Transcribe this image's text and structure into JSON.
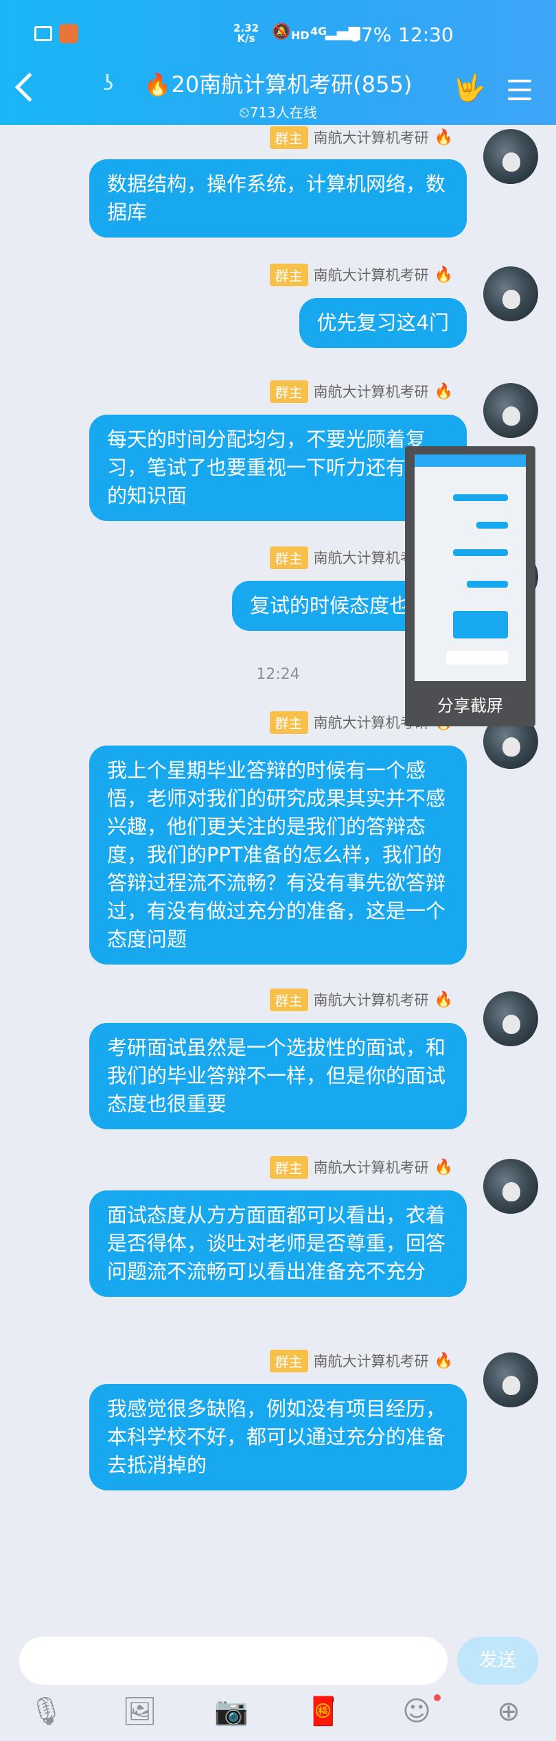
{
  "status_bar": {
    "speed_value": "2.32",
    "speed_unit": "K/s",
    "hd": "HD",
    "net": "4G",
    "battery": "67%",
    "time": "12:30"
  },
  "header": {
    "title": "🔥20南航计算机考研(855)",
    "online": "⏲713人在线"
  },
  "messages": [
    {
      "role": "群主",
      "sender": "南航大计算机考研",
      "text": "数据结构，操作系统，计算机网络，数据库"
    },
    {
      "role": "群主",
      "sender": "南航大计算机考研",
      "text": "优先复习这4门"
    },
    {
      "role": "群主",
      "sender": "南航大计算机考研",
      "text": "每天的时间分配均匀，不要光顾着复习，笔试了也要重视一下听力还有面试的知识面"
    },
    {
      "role": "群主",
      "sender": "南航大计算机考研",
      "text": "复试的时候态度也很重"
    },
    {
      "role": "群主",
      "sender": "南航大计算机考研",
      "text": "我上个星期毕业答辩的时候有一个感悟，老师对我们的研究成果其实并不感兴趣，他们更关注的是我们的答辩态度，我们的PPT准备的怎么样，我们的答辩过程流不流畅？有没有事先欲答辩过，有没有做过充分的准备，这是一个态度问题"
    },
    {
      "role": "群主",
      "sender": "南航大计算机考研",
      "text": "考研面试虽然是一个选拔性的面试，和我们的毕业答辩不一样，但是你的面试态度也很重要"
    },
    {
      "role": "群主",
      "sender": "南航大计算机考研",
      "text": "面试态度从方方面面都可以看出，衣着是否得体，谈吐对老师是否尊重，回答问题流不流畅可以看出准备充不充分"
    },
    {
      "role": "群主",
      "sender": "南航大计算机考研",
      "text": "我感觉很多缺陷，例如没有项目经历，本科学校不好，都可以通过充分的准备去抵消掉的"
    }
  ],
  "timestamp": "12:24",
  "share_popup": {
    "label": "分享截屏"
  },
  "input": {
    "placeholder": "",
    "send_label": "发送"
  },
  "toolbar_icons": [
    "microphone-icon",
    "image-icon",
    "camera-icon",
    "red-packet-icon",
    "emoji-icon",
    "plus-icon"
  ]
}
